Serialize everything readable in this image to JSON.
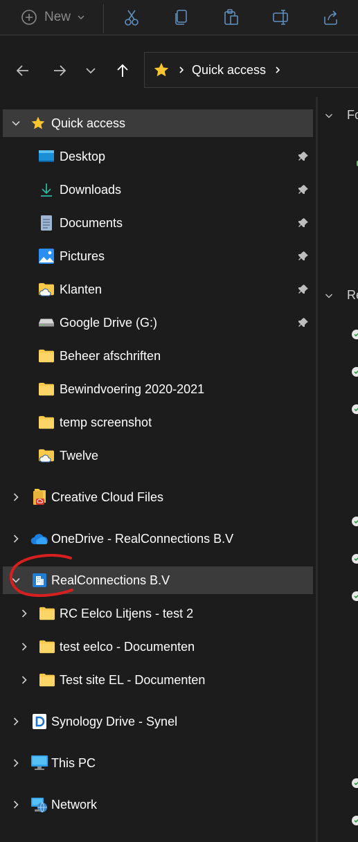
{
  "toolbar": {
    "new_label": "New",
    "buttons": [
      "cut-icon",
      "copy-icon",
      "paste-icon",
      "rename-icon",
      "share-icon"
    ]
  },
  "address_bar": {
    "crumbs": [
      "Quick access"
    ]
  },
  "nav": {
    "quick_access": {
      "label": "Quick access",
      "items": [
        {
          "label": "Desktop",
          "icon": "desktop-icon",
          "pinned": true
        },
        {
          "label": "Downloads",
          "icon": "download-icon",
          "pinned": true
        },
        {
          "label": "Documents",
          "icon": "documents-icon",
          "pinned": true
        },
        {
          "label": "Pictures",
          "icon": "pictures-icon",
          "pinned": true
        },
        {
          "label": "Klanten",
          "icon": "cloud-folder-icon",
          "pinned": true
        },
        {
          "label": "Google Drive (G:)",
          "icon": "drive-icon",
          "pinned": true
        },
        {
          "label": "Beheer afschriften",
          "icon": "folder-icon",
          "pinned": false
        },
        {
          "label": "Bewindvoering 2020-2021",
          "icon": "folder-icon",
          "pinned": false
        },
        {
          "label": "temp screenshot",
          "icon": "folder-icon",
          "pinned": false
        },
        {
          "label": "Twelve",
          "icon": "cloud-folder-icon",
          "pinned": false
        }
      ]
    },
    "creative_cloud": {
      "label": "Creative Cloud Files"
    },
    "onedrive": {
      "label": "OneDrive - RealConnections B.V"
    },
    "realconnections": {
      "label": "RealConnections B.V",
      "children": [
        {
          "label": "RC Eelco Litjens - test 2"
        },
        {
          "label": "test eelco - Documenten"
        },
        {
          "label": "Test site EL - Documenten"
        }
      ]
    },
    "synology": {
      "label": "Synology Drive - Synel"
    },
    "this_pc": {
      "label": "This PC"
    },
    "network": {
      "label": "Network"
    }
  },
  "content": {
    "section_folders": "Fol",
    "section_recent": "Rec"
  },
  "colors": {
    "background": "#1c1c1c",
    "selected_row": "#3b3b3b",
    "folder_yellow": "#f8c94a",
    "annotation_red": "#d61f1f"
  }
}
